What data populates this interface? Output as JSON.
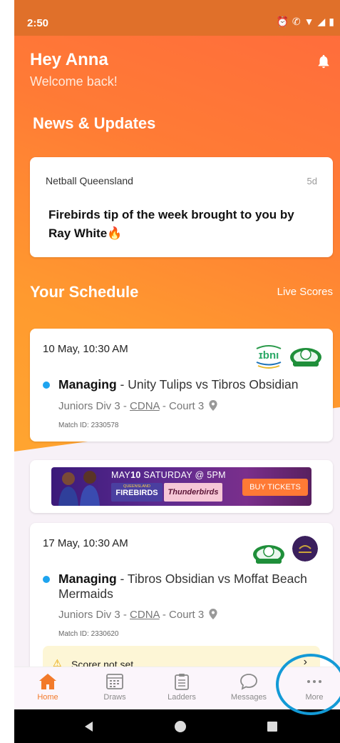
{
  "status_bar": {
    "time": "2:50"
  },
  "header": {
    "greeting": "Hey Anna",
    "subtitle": "Welcome back!"
  },
  "news": {
    "section_title": "News & Updates",
    "items": [
      {
        "source": "Netball Queensland",
        "age": "5d",
        "title": "Firebirds tip of the week brought to you by Ray White🔥"
      }
    ]
  },
  "schedule": {
    "section_title": "Your Schedule",
    "live_scores_label": "Live Scores",
    "matches": [
      {
        "date": "10 May, 10:30 AM",
        "role": "Managing",
        "teams": " - Unity Tulips vs Tibros Obsidian",
        "division": "Juniors Div 3 - ",
        "venue": "CDNA",
        "court": " - Court 3",
        "match_id": "Match ID: 2330578"
      },
      {
        "date": "17 May, 10:30 AM",
        "role": "Managing",
        "teams": " - Tibros Obsidian vs Moffat Beach Mermaids",
        "division": "Juniors Div 3 - ",
        "venue": "CDNA",
        "court": " - Court 3",
        "match_id": "Match ID: 2330620",
        "warning": "Scorer not set"
      }
    ]
  },
  "banner": {
    "date_text_part1": "MAY",
    "date_text_day": "10",
    "date_text_part2": " SATURDAY @ 5PM",
    "team_home": "FIREBIRDS",
    "team_home_sub": "QUEENSLAND",
    "team_away": "Thunderbirds",
    "cta": "BUY TICKETS"
  },
  "nav": {
    "items": [
      {
        "label": "Home",
        "icon": "home-icon",
        "active": true
      },
      {
        "label": "Draws",
        "icon": "calendar-icon",
        "active": false
      },
      {
        "label": "Ladders",
        "icon": "clipboard-icon",
        "active": false
      },
      {
        "label": "Messages",
        "icon": "chat-icon",
        "active": false
      },
      {
        "label": "More",
        "icon": "more-dots-icon",
        "active": false
      }
    ]
  },
  "colors": {
    "accent": "#ff7a35",
    "active_nav": "#f27a2a",
    "dot": "#1ea4ef",
    "highlight_circle": "#139ad6"
  }
}
